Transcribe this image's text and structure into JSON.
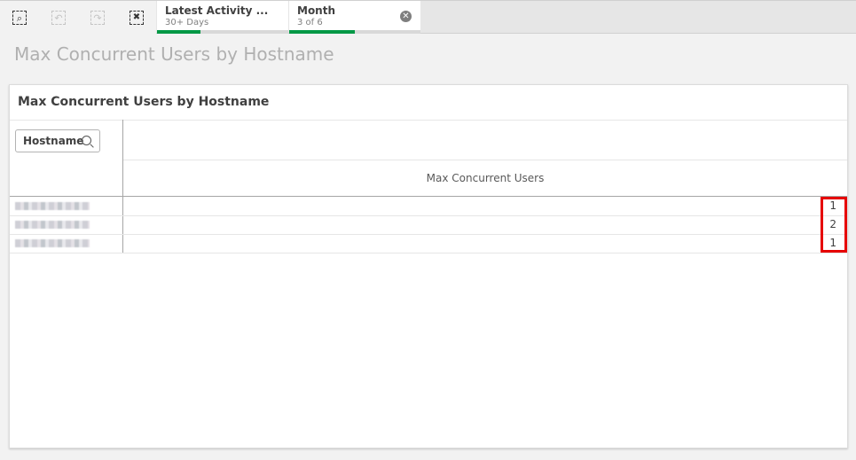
{
  "toolbar": {
    "buttons": [
      {
        "name": "smart-search",
        "icon": "search-icon",
        "enabled": true
      },
      {
        "name": "step-back",
        "icon": "undo-icon",
        "enabled": false
      },
      {
        "name": "step-forward",
        "icon": "redo-icon",
        "enabled": false
      },
      {
        "name": "clear-all-selections",
        "icon": "clear-selections-icon",
        "enabled": true
      }
    ],
    "selections": [
      {
        "field": "Latest Activity ...",
        "value": "30+ Days",
        "selected_fraction": 0.33
      },
      {
        "field": "Month",
        "value": "3 of 6",
        "selected_fraction": 0.5,
        "clear_icon": "close-circle-icon"
      }
    ]
  },
  "sheet": {
    "title": "Max Concurrent Users by Hostname"
  },
  "table": {
    "title": "Max Concurrent Users by Hostname",
    "dimension_label": "Hostname",
    "measure_label": "Max Concurrent Users",
    "rows": [
      {
        "hostname": "(redacted)",
        "value": "1"
      },
      {
        "hostname": "(redacted)",
        "value": "2"
      },
      {
        "hostname": "(redacted)",
        "value": "1"
      }
    ],
    "highlight_color": "#e60000"
  },
  "colors": {
    "accent_green": "#009845",
    "background": "#f2f2f2"
  }
}
